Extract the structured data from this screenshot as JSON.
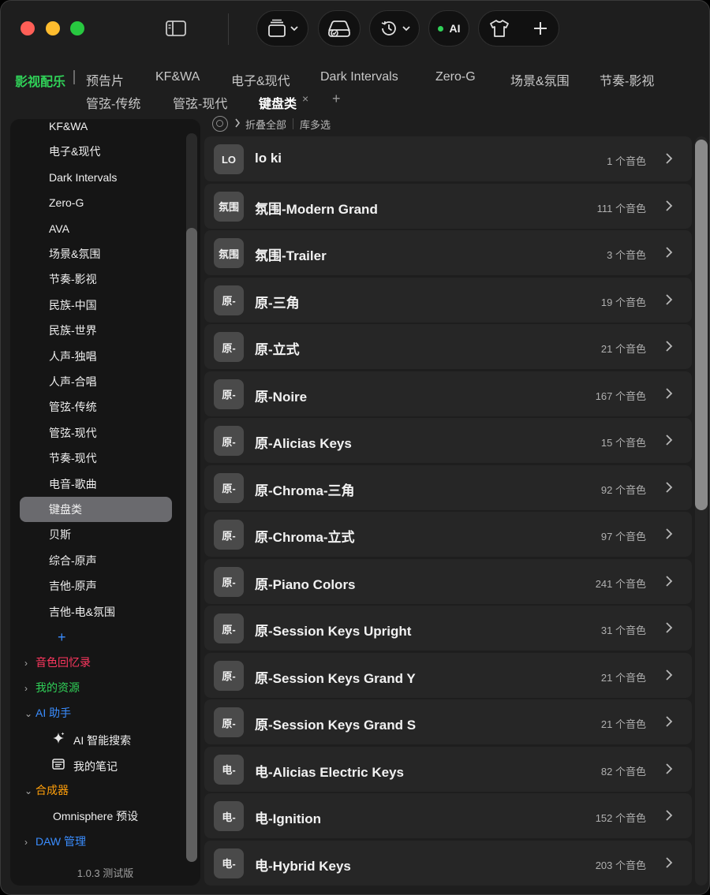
{
  "tabs": {
    "category": "影视配乐",
    "row1": [
      "预告片",
      "KF&WA",
      "电子&现代",
      "Dark Intervals",
      "Zero-G",
      "场景&氛围",
      "节奏-影视"
    ],
    "row2": [
      "管弦-传统",
      "管弦-现代",
      "键盘类"
    ],
    "close_glyph": "×",
    "add_glyph": "+"
  },
  "toolbar": {
    "ai_label": "AI"
  },
  "sidebar": {
    "items": [
      "KF&WA",
      "电子&现代",
      "Dark Intervals",
      "Zero-G",
      "AVA",
      "场景&氛围",
      "节奏-影视",
      "民族-中国",
      "民族-世界",
      "人声-独唱",
      "人声-合唱",
      "管弦-传统",
      "管弦-现代",
      "节奏-现代",
      "电音-歌曲",
      "键盘类",
      "贝斯",
      "综合-原声",
      "吉他-原声",
      "吉他-电&氛围"
    ],
    "selected_index": 15,
    "add_glyph": "+",
    "sections": {
      "memory": {
        "label": "音色回忆录",
        "chevron": "›",
        "color": "#ff375f"
      },
      "resources": {
        "label": "我的资源",
        "chevron": "›",
        "color": "#30d158"
      },
      "ai_assistant": {
        "label": "AI 助手",
        "chevron": "⌄",
        "color": "#3a8dff"
      },
      "ai_search": "AI 智能搜索",
      "notes": "我的笔记",
      "synth": {
        "label": "合成器",
        "chevron": "⌄",
        "color": "#ff9f0a"
      },
      "omnisphere": "Omnisphere 预设",
      "daw": {
        "label": "DAW 管理",
        "chevron": "›",
        "color": "#3a8dff"
      }
    },
    "version": "1.0.3 测试版"
  },
  "main": {
    "collapse_all": "折叠全部",
    "multi_select": "库多选",
    "rows": [
      {
        "badge": "LO",
        "name": "lo ki",
        "count": "1 个音色"
      },
      {
        "badge": "氛围",
        "name": "氛围-Modern Grand",
        "count": "111 个音色"
      },
      {
        "badge": "氛围",
        "name": "氛围-Trailer",
        "count": "3 个音色"
      },
      {
        "badge": "原-",
        "name": "原-三角",
        "count": "19 个音色"
      },
      {
        "badge": "原-",
        "name": "原-立式",
        "count": "21 个音色"
      },
      {
        "badge": "原-",
        "name": "原-Noire",
        "count": "167 个音色"
      },
      {
        "badge": "原-",
        "name": "原-Alicias Keys",
        "count": "15 个音色"
      },
      {
        "badge": "原-",
        "name": "原-Chroma-三角",
        "count": "92 个音色"
      },
      {
        "badge": "原-",
        "name": "原-Chroma-立式",
        "count": "97 个音色"
      },
      {
        "badge": "原-",
        "name": "原-Piano Colors",
        "count": "241 个音色"
      },
      {
        "badge": "原-",
        "name": "原-Session Keys Upright",
        "count": "31 个音色"
      },
      {
        "badge": "原-",
        "name": "原-Session Keys Grand Y",
        "count": "21 个音色"
      },
      {
        "badge": "原-",
        "name": "原-Session Keys Grand S",
        "count": "21 个音色"
      },
      {
        "badge": "电-",
        "name": "电-Alicias Electric Keys",
        "count": "82 个音色"
      },
      {
        "badge": "电-",
        "name": "电-Ignition",
        "count": "152 个音色"
      },
      {
        "badge": "电-",
        "name": "电-Hybrid Keys",
        "count": "203 个音色"
      }
    ]
  }
}
